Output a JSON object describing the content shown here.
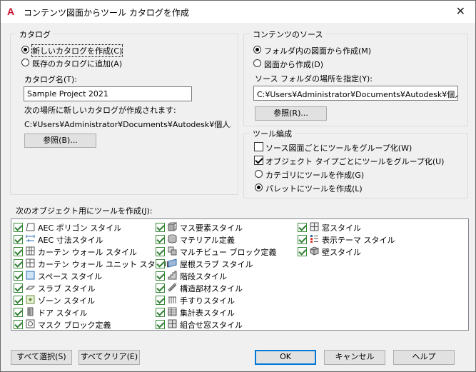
{
  "window": {
    "title": "コンテンツ図面からツール カタログを作成",
    "close_glyph": "✕"
  },
  "catalog": {
    "legend": "カタログ",
    "option_new": "新しいカタログを作成(C)",
    "option_existing": "既存のカタログに追加(A)",
    "name_label": "カタログ名(T):",
    "name_value": "Sample Project 2021",
    "location_label": "次の場所に新しいカタログが作成されます:",
    "location_path": "C:¥Users¥Administrator¥Documents¥Autodesk¥個人...",
    "browse_label": "参照(B)..."
  },
  "source": {
    "legend": "コンテンツのソース",
    "option_folder": "フォルダ内の図面から作成(M)",
    "option_drawing": "図面から作成(D)",
    "folder_label": "ソース フォルダの場所を指定(Y):",
    "folder_value": "C:¥Users¥Administrator¥Documents¥Autodesk¥個人用",
    "browse_label": "参照(R)..."
  },
  "tool_org": {
    "legend": "ツール編成",
    "group_by_source": "ソース図面ごとにツールをグループ化(W)",
    "group_by_type": "オブジェクト タイプごとにツールをグループ化(U)",
    "create_category": "カテゴリにツールを作成(G)",
    "create_palette": "パレットにツールを作成(L)",
    "group_by_source_checked": false,
    "group_by_type_checked": true,
    "selected_option": "palette"
  },
  "objects": {
    "label": "次のオブジェクト用にツールを作成(J):",
    "columns": [
      [
        {
          "label": "AEC ポリゴン スタイル",
          "icon": "polygon-icon",
          "checked": true
        },
        {
          "label": "AEC 寸法スタイル",
          "icon": "dimension-icon",
          "checked": true
        },
        {
          "label": "カーテン ウォール スタイル",
          "icon": "curtain-wall-icon",
          "checked": true
        },
        {
          "label": "カーテン ウォール ユニット スタイル",
          "icon": "curtain-wall-unit-icon",
          "checked": true
        },
        {
          "label": "スペース スタイル",
          "icon": "space-icon",
          "checked": true
        },
        {
          "label": "スラブ スタイル",
          "icon": "slab-icon",
          "checked": true
        },
        {
          "label": "ゾーン スタイル",
          "icon": "zone-icon",
          "checked": true
        },
        {
          "label": "ドア スタイル",
          "icon": "door-icon",
          "checked": true
        },
        {
          "label": "マスク ブロック定義",
          "icon": "mask-block-icon",
          "checked": true
        }
      ],
      [
        {
          "label": "マス要素スタイル",
          "icon": "mass-element-icon",
          "checked": true
        },
        {
          "label": "マテリアル定義",
          "icon": "material-icon",
          "checked": true
        },
        {
          "label": "マルチビュー ブロック定義",
          "icon": "multiview-block-icon",
          "checked": true
        },
        {
          "label": "屋根スラブ スタイル",
          "icon": "roof-slab-icon",
          "checked": true
        },
        {
          "label": "階段スタイル",
          "icon": "stair-icon",
          "checked": true
        },
        {
          "label": "構造部材スタイル",
          "icon": "structural-member-icon",
          "checked": true
        },
        {
          "label": "手すりスタイル",
          "icon": "railing-icon",
          "checked": true
        },
        {
          "label": "集計表スタイル",
          "icon": "schedule-table-icon",
          "checked": true
        },
        {
          "label": "組合せ窓スタイル",
          "icon": "window-assembly-icon",
          "checked": true
        }
      ],
      [
        {
          "label": "窓スタイル",
          "icon": "window-icon",
          "checked": true
        },
        {
          "label": "表示テーマ スタイル",
          "icon": "display-theme-icon",
          "checked": true
        },
        {
          "label": "壁スタイル",
          "icon": "wall-icon",
          "checked": true
        }
      ]
    ]
  },
  "buttons": {
    "select_all": "すべて選択(S)",
    "clear_all": "すべてクリア(E)",
    "ok": "OK",
    "cancel": "キャンセル",
    "help": "ヘルプ"
  }
}
